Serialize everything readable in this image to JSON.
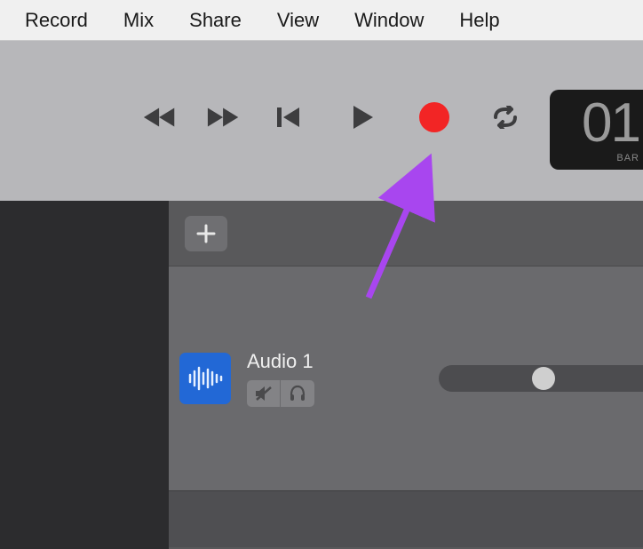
{
  "menubar": {
    "items": [
      "Record",
      "Mix",
      "Share",
      "View",
      "Window",
      "Help"
    ]
  },
  "transport": {
    "lcd_value": "01",
    "lcd_label": "BAR"
  },
  "tracks": {
    "track1": {
      "name": "Audio 1"
    }
  }
}
